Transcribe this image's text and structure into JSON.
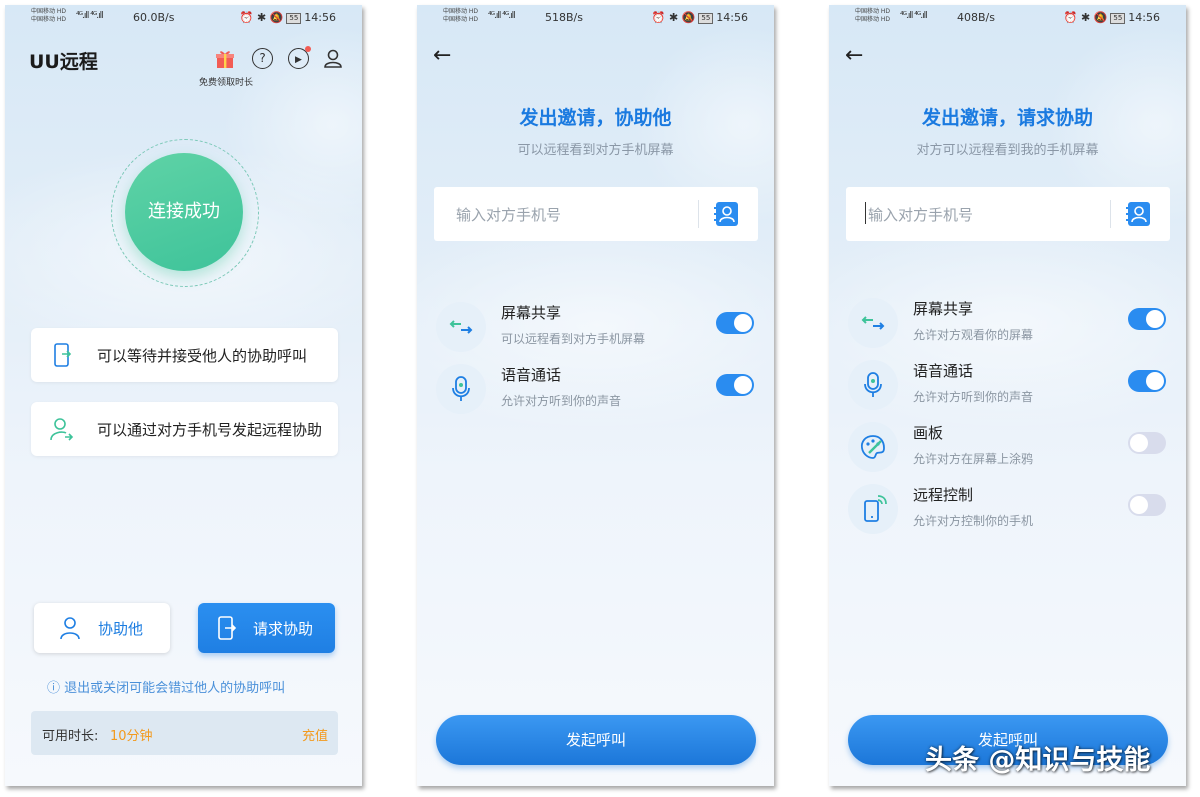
{
  "screen1": {
    "status": {
      "carrier_line1": "中国移动 HD",
      "carrier_line2": "中国移动 HD",
      "signal": "⁴ᴳ.ıll ⁴ᴳ.ıll",
      "speed": "60.0B/s",
      "battery": "55",
      "time": "14:56"
    },
    "app_title": "UU远程",
    "gift_label": "免费领取时长",
    "connect_status": "连接成功",
    "cards": [
      {
        "label": "可以等待并接受他人的协助呼叫"
      },
      {
        "label": "可以通过对方手机号发起远程协助"
      }
    ],
    "help_button": "协助他",
    "request_button": "请求协助",
    "notice": "ⓘ 退出或关闭可能会错过他人的协助呼叫",
    "time_label": "可用时长:",
    "time_value": "10分钟",
    "recharge": "充值"
  },
  "screen2": {
    "status": {
      "carrier_line1": "中国移动 HD",
      "carrier_line2": "中国移动 HD",
      "signal": "⁴ᴳ.ıll ⁴ᴳ.ıll",
      "speed": "518B/s",
      "battery": "55",
      "time": "14:56"
    },
    "title": "发出邀请，协助他",
    "subtitle": "可以远程看到对方手机屏幕",
    "input_placeholder": "输入对方手机号",
    "features": [
      {
        "name": "屏幕共享",
        "desc": "可以远程看到对方手机屏幕",
        "enabled": true,
        "icon": "screen-share-icon"
      },
      {
        "name": "语音通话",
        "desc": "允许对方听到你的声音",
        "enabled": true,
        "icon": "microphone-icon"
      }
    ],
    "call_button": "发起呼叫"
  },
  "screen3": {
    "status": {
      "carrier_line1": "中国移动 HD",
      "carrier_line2": "中国移动 HD",
      "signal": "⁴ᴳ.ıll ⁴ᴳ.ıll",
      "speed": "408B/s",
      "battery": "55",
      "time": "14:56"
    },
    "title": "发出邀请，请求协助",
    "subtitle": "对方可以远程看到我的手机屏幕",
    "input_placeholder": "输入对方手机号",
    "features": [
      {
        "name": "屏幕共享",
        "desc": "允许对方观看你的屏幕",
        "enabled": true,
        "icon": "screen-share-icon"
      },
      {
        "name": "语音通话",
        "desc": "允许对方听到你的声音",
        "enabled": true,
        "icon": "microphone-icon"
      },
      {
        "name": "画板",
        "desc": "允许对方在屏幕上涂鸦",
        "enabled": false,
        "icon": "palette-icon"
      },
      {
        "name": "远程控制",
        "desc": "允许对方控制你的手机",
        "enabled": false,
        "icon": "remote-phone-icon"
      }
    ],
    "call_button": "发起呼叫"
  },
  "watermark": "头条 @知识与技能",
  "colors": {
    "accent": "#1f7fe3",
    "success": "#3ec39a",
    "warning": "#f39a1e",
    "toggle_off": "#d8dcec"
  }
}
